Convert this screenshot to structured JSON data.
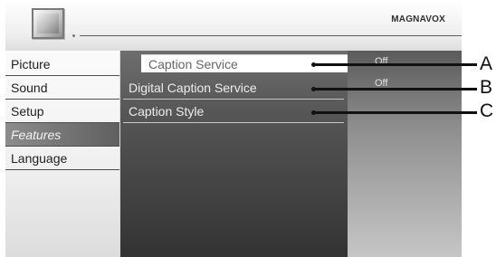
{
  "brand": "MAGNAVOX",
  "menu": [
    {
      "label": "Picture",
      "selected": false
    },
    {
      "label": "Sound",
      "selected": false
    },
    {
      "label": "Setup",
      "selected": false
    },
    {
      "label": "Features",
      "selected": true
    },
    {
      "label": "Language",
      "selected": false
    }
  ],
  "options": [
    {
      "label": "Caption Service",
      "value": "Off",
      "selected": true
    },
    {
      "label": "Digital Caption Service",
      "value": "Off",
      "selected": false
    },
    {
      "label": "Caption Style",
      "value": "",
      "selected": false
    }
  ],
  "callouts": [
    "A",
    "B",
    "C"
  ],
  "icons": {
    "tv": "television-icon"
  }
}
